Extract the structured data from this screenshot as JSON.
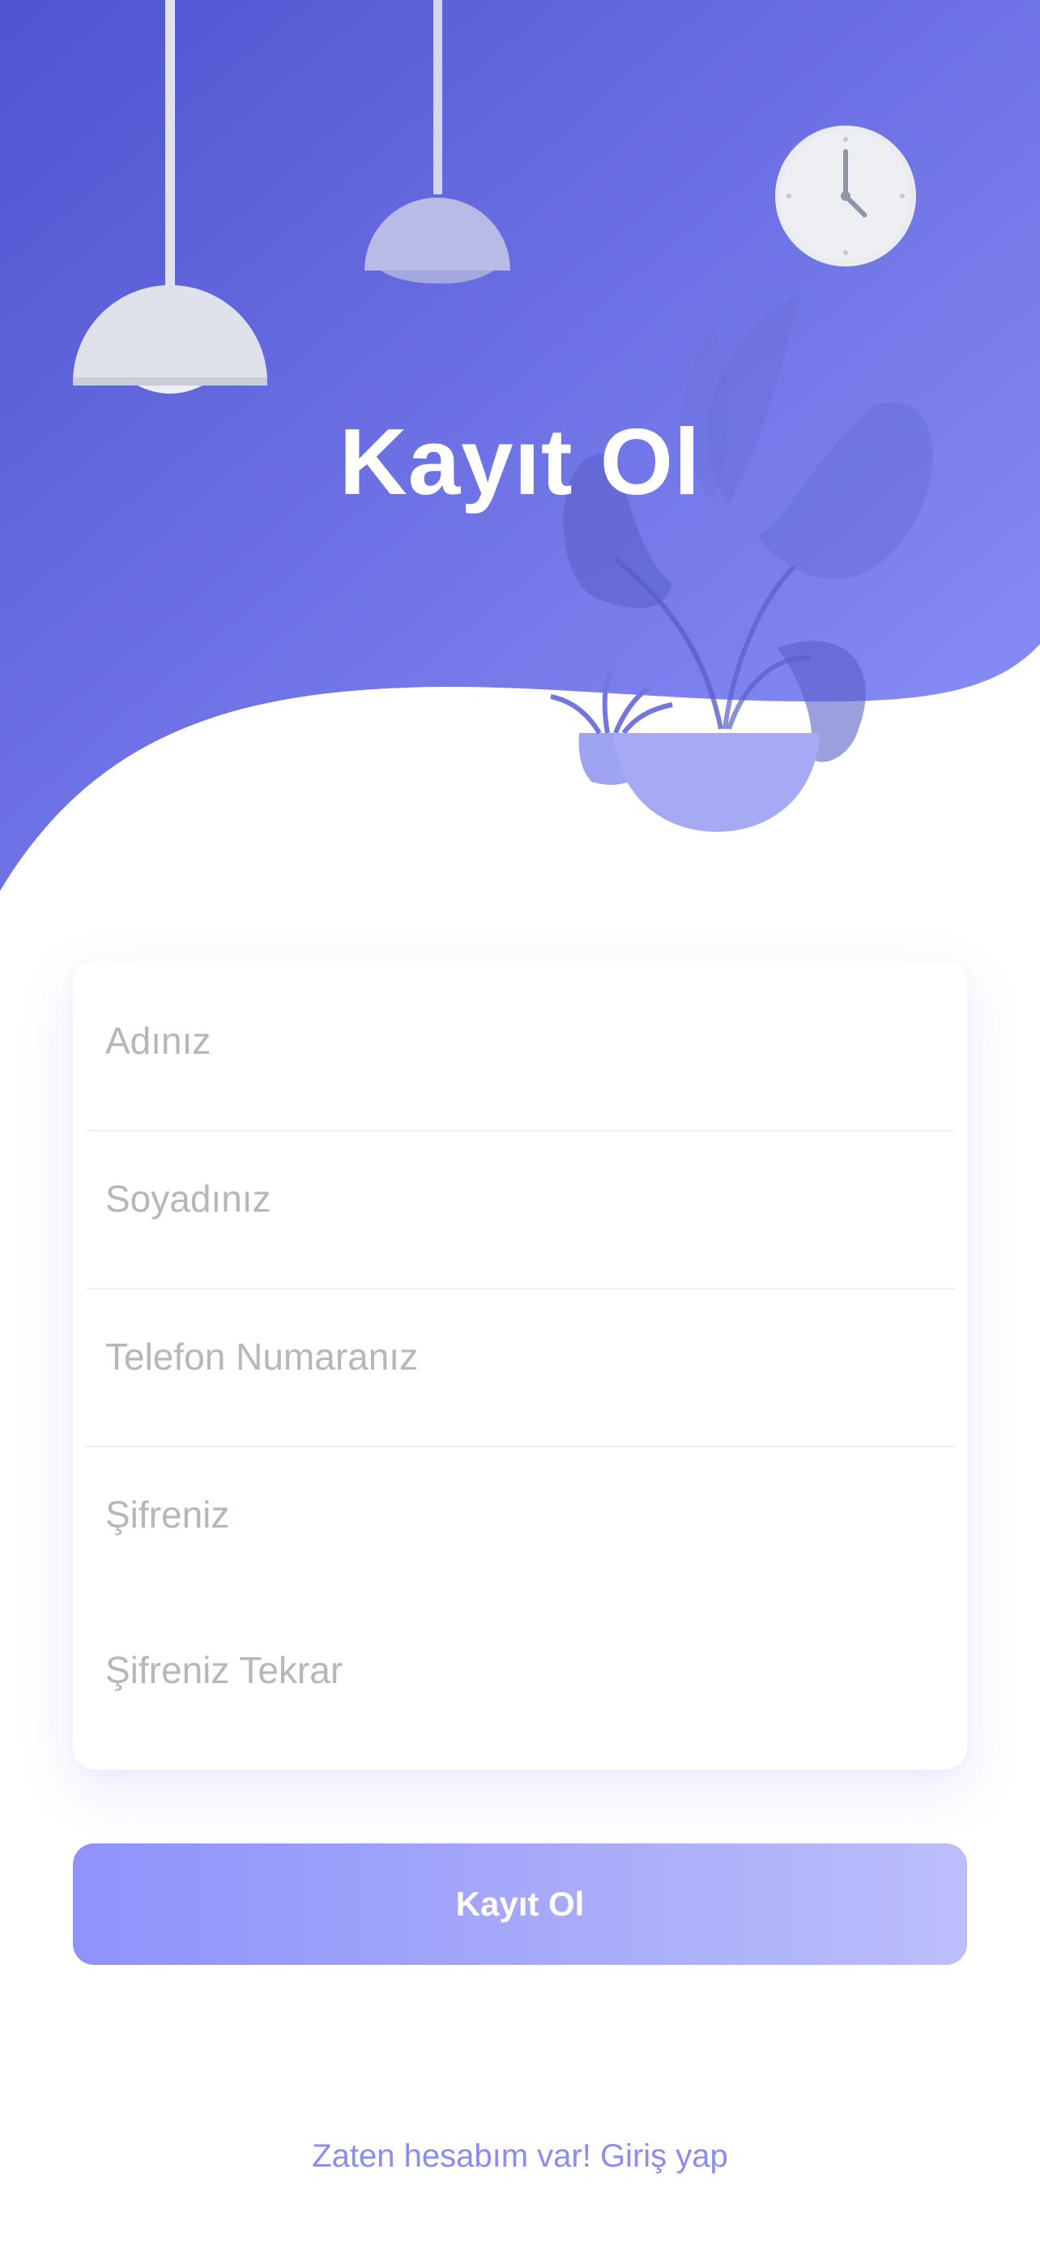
{
  "header": {
    "title": "Kayıt Ol"
  },
  "illustration": {
    "icons": [
      "pendant-lamp-icon",
      "wall-clock-icon",
      "potted-plant-icon"
    ]
  },
  "form": {
    "fields": [
      {
        "placeholder": "Adınız",
        "value": ""
      },
      {
        "placeholder": "Soyadınız",
        "value": ""
      },
      {
        "placeholder": "Telefon Numaranız",
        "value": ""
      },
      {
        "placeholder": "Şifreniz",
        "value": ""
      },
      {
        "placeholder": "Şifreniz Tekrar",
        "value": ""
      }
    ],
    "submit_label": "Kayıt Ol"
  },
  "footer": {
    "login_link": "Zaten hesabım var! Giriş yap"
  },
  "colors": {
    "gradient_start": "#4f54d0",
    "gradient_end": "#8e92fa",
    "accent": "#8a8cf2",
    "button_start": "#8f92fb",
    "button_end": "#bcbefc"
  }
}
